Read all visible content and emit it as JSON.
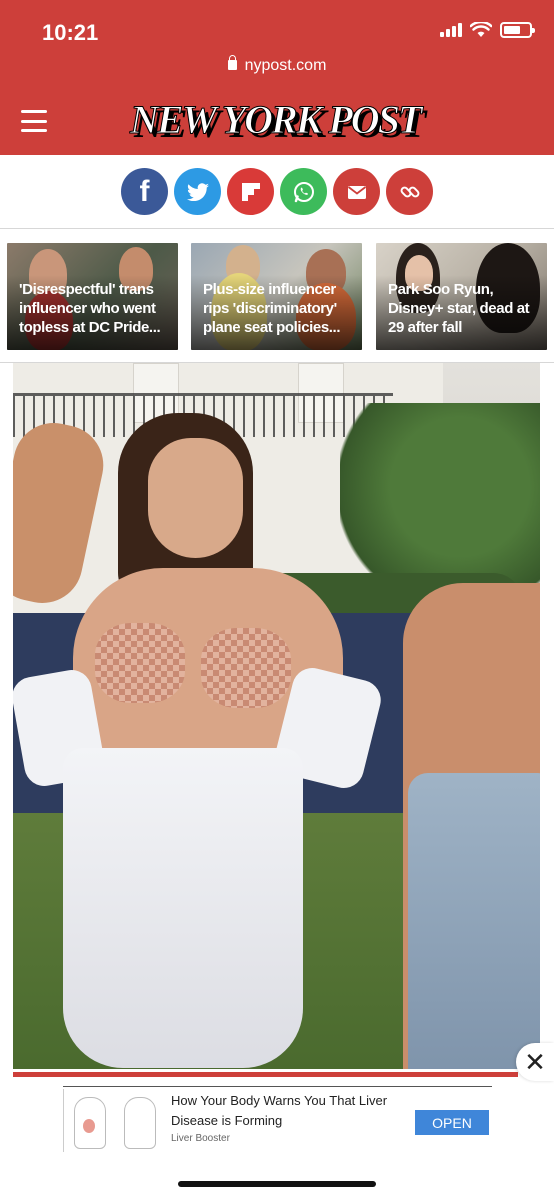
{
  "status_bar": {
    "time": "10:21",
    "battery_level": 0.65
  },
  "browser": {
    "url": "nypost.com"
  },
  "masthead": {
    "logo_text": "NEW YORK POST"
  },
  "share_icons": [
    {
      "name": "facebook-icon",
      "glyph": "f",
      "color": "#3b5998"
    },
    {
      "name": "twitter-icon",
      "glyph": "",
      "color": "#2d9ae4"
    },
    {
      "name": "flipboard-icon",
      "glyph": "",
      "color": "#d93a38"
    },
    {
      "name": "whatsapp-icon",
      "glyph": "",
      "color": "#3dbb5b"
    },
    {
      "name": "email-icon",
      "glyph": "",
      "color": "#cd3f3a"
    },
    {
      "name": "link-icon",
      "glyph": "",
      "color": "#cd3f3a"
    }
  ],
  "stories": [
    {
      "caption": "'Disrespectful' trans influencer who went topless at DC Pride..."
    },
    {
      "caption": "Plus-size influencer rips 'discriminatory' plane seat policies..."
    },
    {
      "caption": "Park Soo Ryun, Disney+ star, dead at 29 after fall"
    }
  ],
  "ad": {
    "title": "How Your Body Warns You That Liver Disease is Forming",
    "source": "Liver Booster",
    "cta": "OPEN"
  },
  "colors": {
    "brand_red": "#cd3f3a",
    "ad_button": "#3f86d9"
  }
}
